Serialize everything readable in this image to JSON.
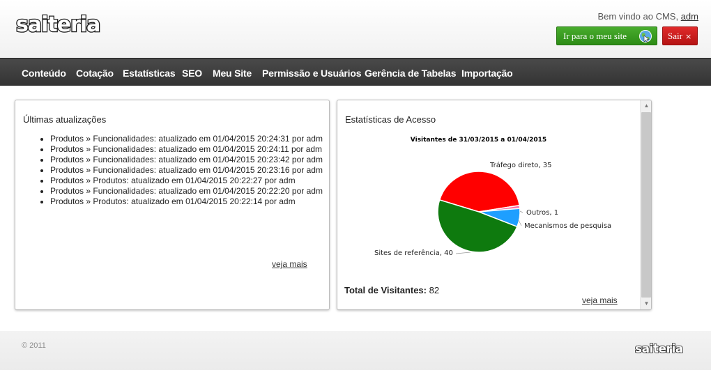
{
  "header": {
    "logo_text": "saiteria",
    "welcome_text": "Bem vindo ao CMS,",
    "user_link": "adm",
    "site_button": "Ir para o meu site",
    "exit_button": "Sair",
    "exit_icon": "×"
  },
  "nav": {
    "items": [
      "Conteúdo",
      "Cotação",
      "Estatísticas",
      "SEO",
      "Meu Site",
      "Permissão e Usuários",
      "Gerência de Tabelas",
      "Importação"
    ]
  },
  "updates_panel": {
    "title": "Últimas atualizações",
    "items": [
      "Produtos » Funcionalidades: atualizado em 01/04/2015 20:24:31 por adm",
      "Produtos » Funcionalidades: atualizado em 01/04/2015 20:24:11 por adm",
      "Produtos » Funcionalidades: atualizado em 01/04/2015 20:23:42 por adm",
      "Produtos » Funcionalidades: atualizado em 01/04/2015 20:23:16 por adm",
      "Produtos » Produtos: atualizado em 01/04/2015 20:22:27 por adm",
      "Produtos » Funcionalidades: atualizado em 01/04/2015 20:22:20 por adm",
      "Produtos » Produtos: atualizado em 01/04/2015 20:22:14 por adm"
    ],
    "more_link": "veja mais"
  },
  "stats_panel": {
    "title": "Estatísticas de Acesso",
    "total_label": "Total de Visitantes:",
    "total_value": "82",
    "more_link": "veja mais"
  },
  "chart_data": {
    "type": "pie",
    "title": "Visitantes de 31/03/2015 a 01/04/2015",
    "slices": [
      {
        "label": "Tráfego direto",
        "value": 35,
        "color": "#ff0000"
      },
      {
        "label": "Outros",
        "value": 1,
        "color": "#ff6fa8"
      },
      {
        "label": "Mecanismos de pesquisa",
        "value": 6,
        "color": "#1e9fff"
      },
      {
        "label": "Sites de referência",
        "value": 40,
        "color": "#0e7a0e"
      }
    ],
    "data_labels": [
      "Tráfego direto, 35",
      "Outros, 1",
      "Mecanismos de pesquisa",
      "Sites de referência, 40"
    ]
  },
  "footer": {
    "copyright": "© 2011",
    "logo_text": "saiteria"
  }
}
